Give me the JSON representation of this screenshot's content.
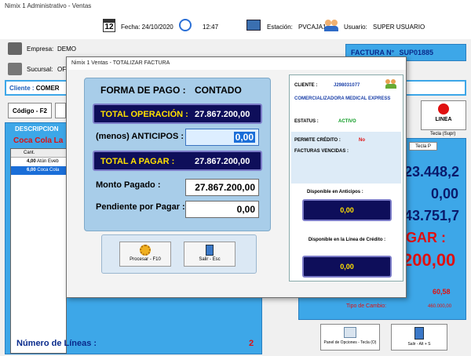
{
  "window": {
    "title": "Nimix 1 Administrativo - Ventas"
  },
  "topbar": {
    "calendar_day": "12",
    "fecha": "Fecha: 24/10/2020",
    "hora": "12:47",
    "estacion_label": "Estación:",
    "estacion_value": "PVCAJA1",
    "usuario_label": "Usuario:",
    "usuario_value": "SUPER USUARIO"
  },
  "left": {
    "empresa_label": "Empresa:",
    "empresa_value": "DEMO",
    "sucursal_label": "Sucursal:",
    "sucursal_value": "OFI",
    "cliente_label": "Cliente :",
    "cliente_value": "COMER",
    "codigo_button": "Código - F2",
    "descripcion_header": "DESCRIPCION",
    "descripcion_value": "Coca Cola La",
    "cant_header": "Cant.",
    "rows": [
      {
        "cant": "4,00",
        "desc": "Atún Eveb"
      },
      {
        "cant": "6,00",
        "desc": "Coca Cola"
      }
    ],
    "num_lineas_label": "Número de Líneas :",
    "num_lineas_value": "2"
  },
  "right": {
    "factura_label": "FACTURA N°",
    "factura_value": "SUP01885",
    "linea_button": "LINEA",
    "tecla_supr": "Tecla (Supr)",
    "tecla_p": "Tecla P",
    "val1": "23.448,2",
    "val2": "0,00",
    "val3": "43.751,7",
    "val4": "GAR :",
    "val5": "200,00",
    "val6": "60,58",
    "tipo_cambio_label": "Tipo de Cambio:",
    "tipo_cambio_value": "460.000,00",
    "panel_opciones": "Panel de Opciones - Tecla (O)",
    "salir_alt": "Salir - Alt + S"
  },
  "modal": {
    "title": "Nimix 1 Ventas - TOTALIZAR FACTURA",
    "forma_pago_label": "FORMA DE PAGO :",
    "forma_pago_value": "CONTADO",
    "total_operacion_label": "TOTAL OPERACIÓN :",
    "total_operacion_value": "27.867.200,00",
    "anticipos_label": "(menos) ANTICIPOS :",
    "anticipos_value": "0,00",
    "total_pagar_label": "TOTAL A PAGAR :",
    "total_pagar_value": "27.867.200,00",
    "monto_pagado_label": "Monto Pagado :",
    "monto_pagado_value": "27.867.200,00",
    "pendiente_label": "Pendiente por Pagar :",
    "pendiente_value": "0,00",
    "procesar_button": "Procesar - F10",
    "salir_button": "Salir - Esc",
    "cliente_label": "CLIENTE :",
    "cliente_rif": "J298031077",
    "cliente_nombre": "COMERCIALIZADORA MEDICAL EXPRESS",
    "estatus_label": "ESTATUS :",
    "estatus_value": "ACTIVO",
    "permite_credito_label": "PERMITE CRÉDITO :",
    "permite_credito_value": "No",
    "facturas_vencidas_label": "FACTURAS VENCIDAS :",
    "disp_anticipos_label": "Disponible en Anticipos :",
    "disp_anticipos_value": "0,00",
    "disp_credito_label": "Disponible en la Línea de Crédito :",
    "disp_credito_value": "0,00"
  },
  "colors": {
    "accent_blue": "#3da7e8",
    "navy": "#0e0e5a",
    "yellow": "#ffe000",
    "red": "#e01010"
  }
}
